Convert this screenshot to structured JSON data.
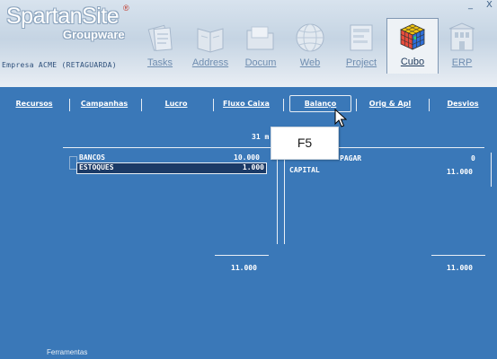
{
  "app": {
    "brand": "SpartanSite",
    "reg_mark": "®",
    "subtitle": "Groupware",
    "company": "Empresa ACME (RETAGUARDA)",
    "window_controls": [
      "_",
      "X"
    ]
  },
  "modules": [
    {
      "label": "Tasks",
      "icon": "tasks-icon"
    },
    {
      "label": "Address",
      "icon": "address-book-icon"
    },
    {
      "label": "Docum",
      "icon": "document-folder-icon"
    },
    {
      "label": "Web",
      "icon": "globe-icon"
    },
    {
      "label": "Project",
      "icon": "project-icon"
    },
    {
      "label": "Cubo",
      "icon": "rubik-cube-icon",
      "active": true
    },
    {
      "label": "ERP",
      "icon": "erp-building-icon"
    }
  ],
  "tabs": [
    "Recursos",
    "Campanhas",
    "Lucro",
    "Fluxo Caixa",
    "Balanço",
    "Orig & Apl",
    "Desvios"
  ],
  "selected_tab": "Balanço",
  "report": {
    "date_fragment": "31 m",
    "left": [
      {
        "name": "BANCOS",
        "value": "10.000"
      },
      {
        "name": "ESTOQUES",
        "value": "1.000",
        "selected": true
      }
    ],
    "right": [
      {
        "name": "PAGAR",
        "value": "0"
      },
      {
        "name": "CAPITAL",
        "value": "11.000"
      }
    ],
    "left_total": "11.000",
    "right_total": "11.000"
  },
  "tooltip": {
    "text": "F5"
  },
  "footer": {
    "label": "Ferramentas"
  },
  "colors": {
    "background": "#3a78b8",
    "header": "#d8e3ee",
    "selected_row": "#1b3a66"
  }
}
